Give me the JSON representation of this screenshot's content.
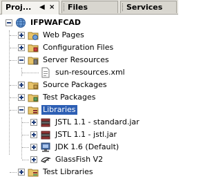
{
  "tabs": [
    {
      "label": "Proj...",
      "active": true
    },
    {
      "label": "Files",
      "active": false
    },
    {
      "label": "Services",
      "active": false
    }
  ],
  "tab_controls": {
    "restore": "◀",
    "close": "×"
  },
  "tree": {
    "root": "IFPWAFCAD",
    "nodes": {
      "web_pages": "Web Pages",
      "configuration_files": "Configuration Files",
      "server_resources": "Server Resources",
      "sun_resources": "sun-resources.xml",
      "source_packages": "Source Packages",
      "test_packages": "Test Packages",
      "libraries": "Libraries",
      "jstl_standard": "JSTL 1.1 - standard.jar",
      "jstl_jstl": "JSTL 1.1 - jstl.jar",
      "jdk": "JDK 1.6 (Default)",
      "glassfish": "GlassFish V2",
      "test_libraries": "Test Libraries"
    }
  },
  "colors": {
    "selection": "#2d5fb4",
    "folder": "#e8c46a",
    "tab_bg": "#e4e2dc"
  }
}
